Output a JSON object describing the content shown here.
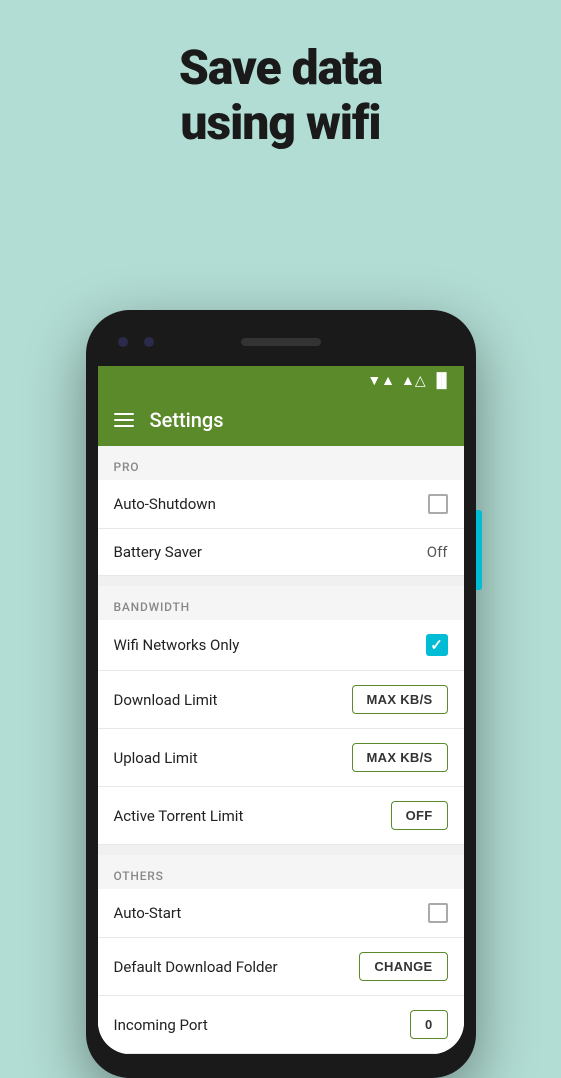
{
  "headline": {
    "line1": "Save data",
    "line2": "using wifi"
  },
  "status": {
    "wifi": "▾▴",
    "signal": "▲",
    "battery": "▐"
  },
  "toolbar": {
    "title": "Settings"
  },
  "sections": [
    {
      "header": "PRO",
      "items": [
        {
          "label": "Auto-Shutdown",
          "control": "checkbox",
          "checked": false,
          "value": ""
        },
        {
          "label": "Battery Saver",
          "control": "value",
          "checked": false,
          "value": "Off"
        }
      ]
    },
    {
      "header": "BANDWIDTH",
      "items": [
        {
          "label": "Wifi Networks Only",
          "control": "checkbox-checked",
          "checked": true,
          "value": ""
        },
        {
          "label": "Download Limit",
          "control": "button",
          "checked": false,
          "value": "MAX KB/S"
        },
        {
          "label": "Upload Limit",
          "control": "button",
          "checked": false,
          "value": "MAX KB/S"
        },
        {
          "label": "Active Torrent Limit",
          "control": "button",
          "checked": false,
          "value": "OFF"
        }
      ]
    },
    {
      "header": "OTHERS",
      "items": [
        {
          "label": "Auto-Start",
          "control": "checkbox",
          "checked": false,
          "value": ""
        },
        {
          "label": "Default Download Folder",
          "control": "button",
          "checked": false,
          "value": "CHANGE"
        },
        {
          "label": "Incoming Port",
          "control": "button",
          "checked": false,
          "value": "0"
        }
      ]
    }
  ]
}
